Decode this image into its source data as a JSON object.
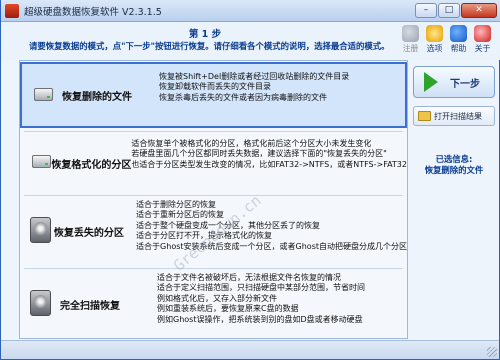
{
  "window": {
    "title": "超级硬盘数据恢复软件 V2.3.1.5"
  },
  "header": {
    "step": "第 1 步",
    "instruction": "请要恢复数据的模式，点\"下一步\"按钮进行恢复。请仔细看各个模式的说明，选择最合适的模式。"
  },
  "toolbar": [
    {
      "label": "注册",
      "icon": "register-icon",
      "enabled": false
    },
    {
      "label": "选项",
      "icon": "options-icon",
      "enabled": true
    },
    {
      "label": "帮助",
      "icon": "help-icon",
      "enabled": true
    },
    {
      "label": "关于",
      "icon": "about-icon",
      "enabled": true
    }
  ],
  "modes": [
    {
      "name": "恢复删除的文件",
      "icon": "drive-icon",
      "selected": true,
      "desc": [
        "恢复被Shift+Del删除或者经过回收站删除的文件目录",
        "恢复卸载软件而丢失的文件目录",
        "恢复杀毒后丢失的文件或者因为病毒删除的文件"
      ]
    },
    {
      "name": "恢复格式化的分区",
      "icon": "drive-icon",
      "selected": false,
      "desc": [
        "适合恢复单个被格式化的分区，格式化前后这个分区大小未发生变化",
        "若硬盘里面几个分区都同时丢失数据，建议选择下面的\"恢复丢失的分区\"",
        "也适合于分区类型发生改变的情况，比如FAT32->NTFS，或者NTFS->FAT32"
      ]
    },
    {
      "name": "恢复丢失的分区",
      "icon": "disk-icon",
      "selected": false,
      "desc": [
        "适合于删除分区的恢复",
        "适合于重新分区后的恢复",
        "适合于整个硬盘变成一个分区，其他分区丢了的恢复",
        "适合于分区打不开，提示格式化的恢复",
        "适合于Ghost安装系统后变成一个分区，或者Ghost自动把硬盘分成几个分区"
      ]
    },
    {
      "name": "完全扫描恢复",
      "icon": "disk-icon",
      "selected": false,
      "desc": [
        "适合于文件名被破坏后，无法根据文件名恢复的情况",
        "适合于定义扫描范围，只扫描硬盘中某部分范围，节省时间",
        "例如格式化后，又存入部分新文件",
        "例如重装系统后，要恢复原来C盘的数据",
        "例如Ghost误操作，把系统装到别的盘如D盘或者移动硬盘"
      ]
    }
  ],
  "sidebar": {
    "next_label": "下一步",
    "open_scan_label": "打开扫描结果",
    "selected_info_label": "已选信息:",
    "selected_info_value": "恢复删除的文件"
  },
  "watermark": "Greendown.cn",
  "colors": {
    "accent": "#0a3d91",
    "selection": "#3b6fd4",
    "next_arrow": "#2da52d"
  }
}
